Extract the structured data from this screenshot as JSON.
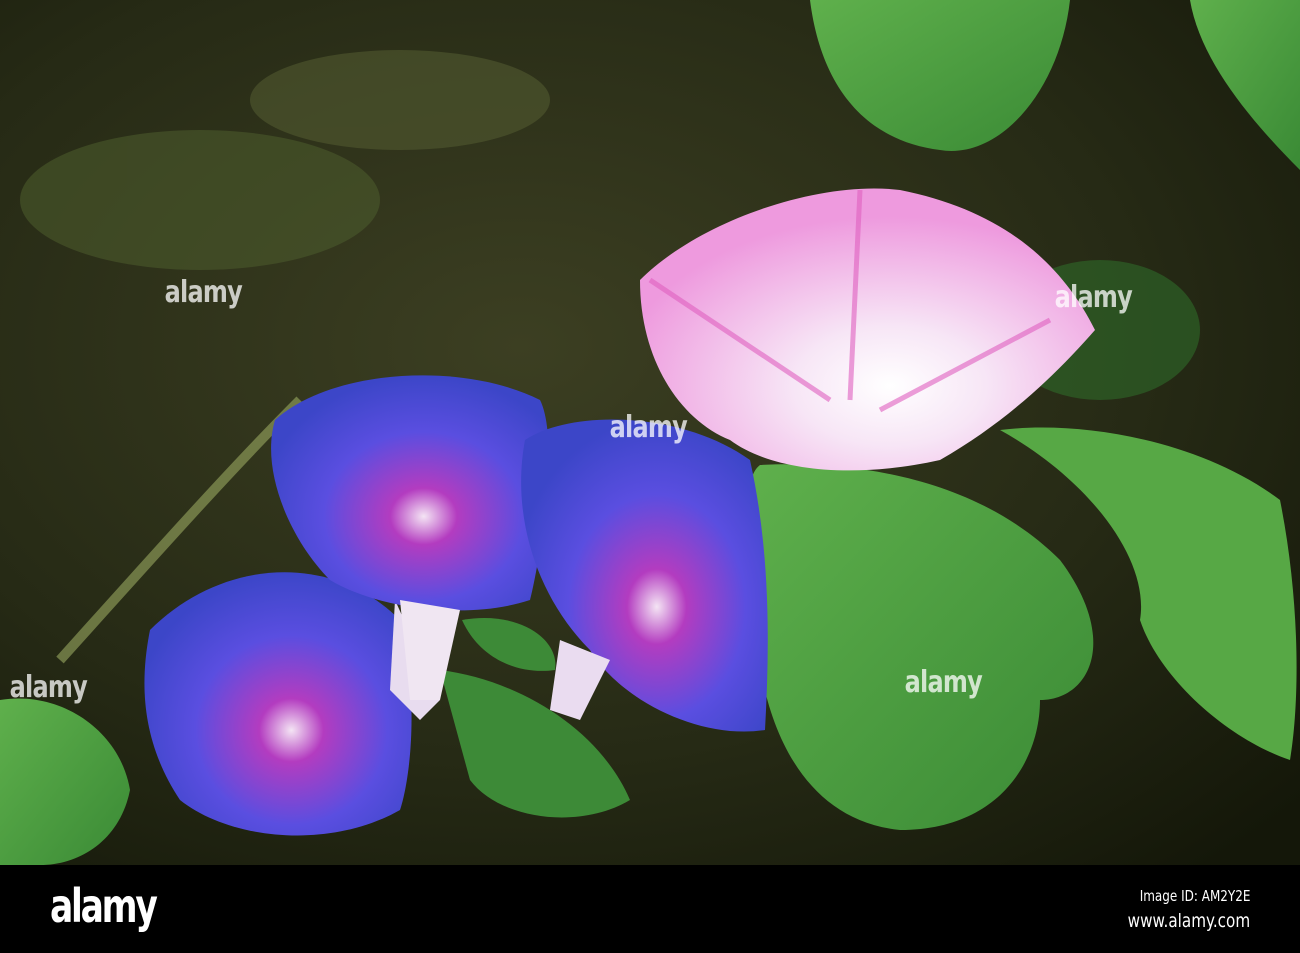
{
  "photo": {
    "subject": "morning glory flowers",
    "colors": {
      "background": "#2b3019",
      "leaf": "#4a9a3c",
      "blue_flower": "#4a4fd8",
      "pink_flower": "#f2b8e8"
    }
  },
  "watermark": {
    "text": "alamy"
  },
  "footer": {
    "logo": "alamy",
    "image_id": "Image ID: AM2Y2E",
    "website": "www.alamy.com"
  }
}
